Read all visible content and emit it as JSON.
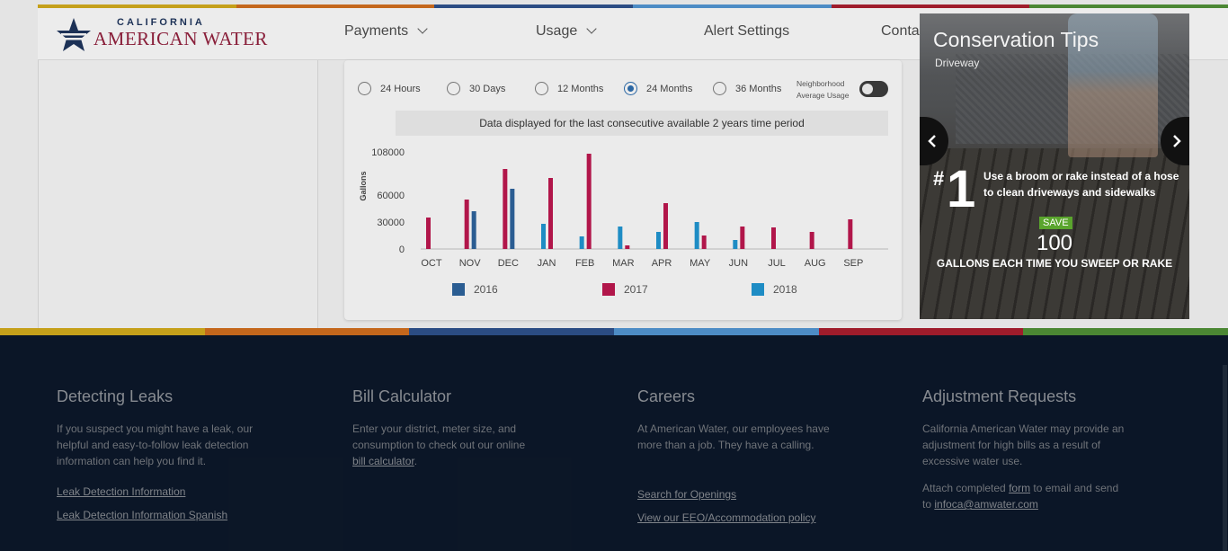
{
  "brand": {
    "line1": "CALIFORNIA",
    "line2": "AMERICAN WATER"
  },
  "nav": {
    "items": [
      "Payments",
      "Usage",
      "Alert Settings",
      "Conta"
    ]
  },
  "usage": {
    "ranges": [
      {
        "label": "24 Hours",
        "selected": false
      },
      {
        "label": "30 Days",
        "selected": false
      },
      {
        "label": "12 Months",
        "selected": false
      },
      {
        "label": "24 Months",
        "selected": true
      },
      {
        "label": "36 Months",
        "selected": false
      }
    ],
    "neighborhood_label_1": "Neighborhood",
    "neighborhood_label_2": "Average Usage",
    "neighborhood_toggle_on": false,
    "notice": "Data displayed for the last consecutive available 2 years time period"
  },
  "chart_data": {
    "type": "bar",
    "categories": [
      "OCT",
      "NOV",
      "DEC",
      "JAN",
      "FEB",
      "MAR",
      "APR",
      "MAY",
      "JUN",
      "JUL",
      "AUG",
      "SEP"
    ],
    "ylabel": "Gallons",
    "yticks": [
      "108000",
      "60000",
      "30000",
      "0"
    ],
    "ytick_values": [
      108000,
      60000,
      30000,
      0
    ],
    "ylim": [
      0,
      108000
    ],
    "series": [
      {
        "name": "2016",
        "color": "#2c5f95",
        "values": [
          0,
          42000,
          67000,
          0,
          0,
          0,
          0,
          0,
          0,
          0,
          0,
          0
        ]
      },
      {
        "name": "2017",
        "color": "#b5174c",
        "values": [
          35000,
          55000,
          89000,
          79000,
          106000,
          4000,
          51000,
          15000,
          25000,
          24000,
          19000,
          33000
        ]
      },
      {
        "name": "2018",
        "color": "#1f8fc8",
        "values": [
          0,
          0,
          0,
          28000,
          14000,
          25000,
          19000,
          30000,
          10000,
          0,
          0,
          0
        ]
      }
    ],
    "bar_order": [
      "2017",
      "2016_or_2018"
    ],
    "legend_position": "bottom",
    "grid": false
  },
  "band_colors": [
    "#c9a41b",
    "#c86a1d",
    "#2c4e86",
    "#4f8fc9",
    "#a31d2c",
    "#4d8a35"
  ],
  "top_stripe_colors": [
    "#c9a41b",
    "#c86a1d",
    "#2c4e86",
    "#4f8fc9",
    "#a31d2c",
    "#4d8a35"
  ],
  "tips": {
    "title": "Conservation Tips",
    "subtitle": "Driveway",
    "hash": "#",
    "number": "1",
    "text": "Use a broom or rake instead of a hose to clean driveways and sidewalks",
    "save_label": "SAVE",
    "amount": "100",
    "unit_text": "GALLONS EACH TIME YOU SWEEP OR RAKE"
  },
  "footer": {
    "leaks": {
      "title": "Detecting Leaks",
      "body": "If you suspect you might have a leak, our helpful and easy-to-follow leak detection information can help you find it.",
      "link1": "Leak Detection Information",
      "link2": "Leak Detection Information Spanish"
    },
    "bill": {
      "title": "Bill Calculator",
      "body": "Enter your district, meter size, and consumption to check out our online",
      "link": "bill calculator",
      "tail": "."
    },
    "careers": {
      "title": "Careers",
      "body": "At American Water, our employees have more than a job. They have a calling.",
      "link1": "Search for Openings",
      "link2": "View our EEO/Accommodation policy"
    },
    "adjust": {
      "title": "Adjustment Requests",
      "body": "California American Water may provide an adjustment for high bills as a result of excessive water use.",
      "attach1": "Attach completed",
      "form_link": "form",
      "attach2": "to email and send",
      "to": "to",
      "email_link": "infoca@amwater.com"
    }
  }
}
